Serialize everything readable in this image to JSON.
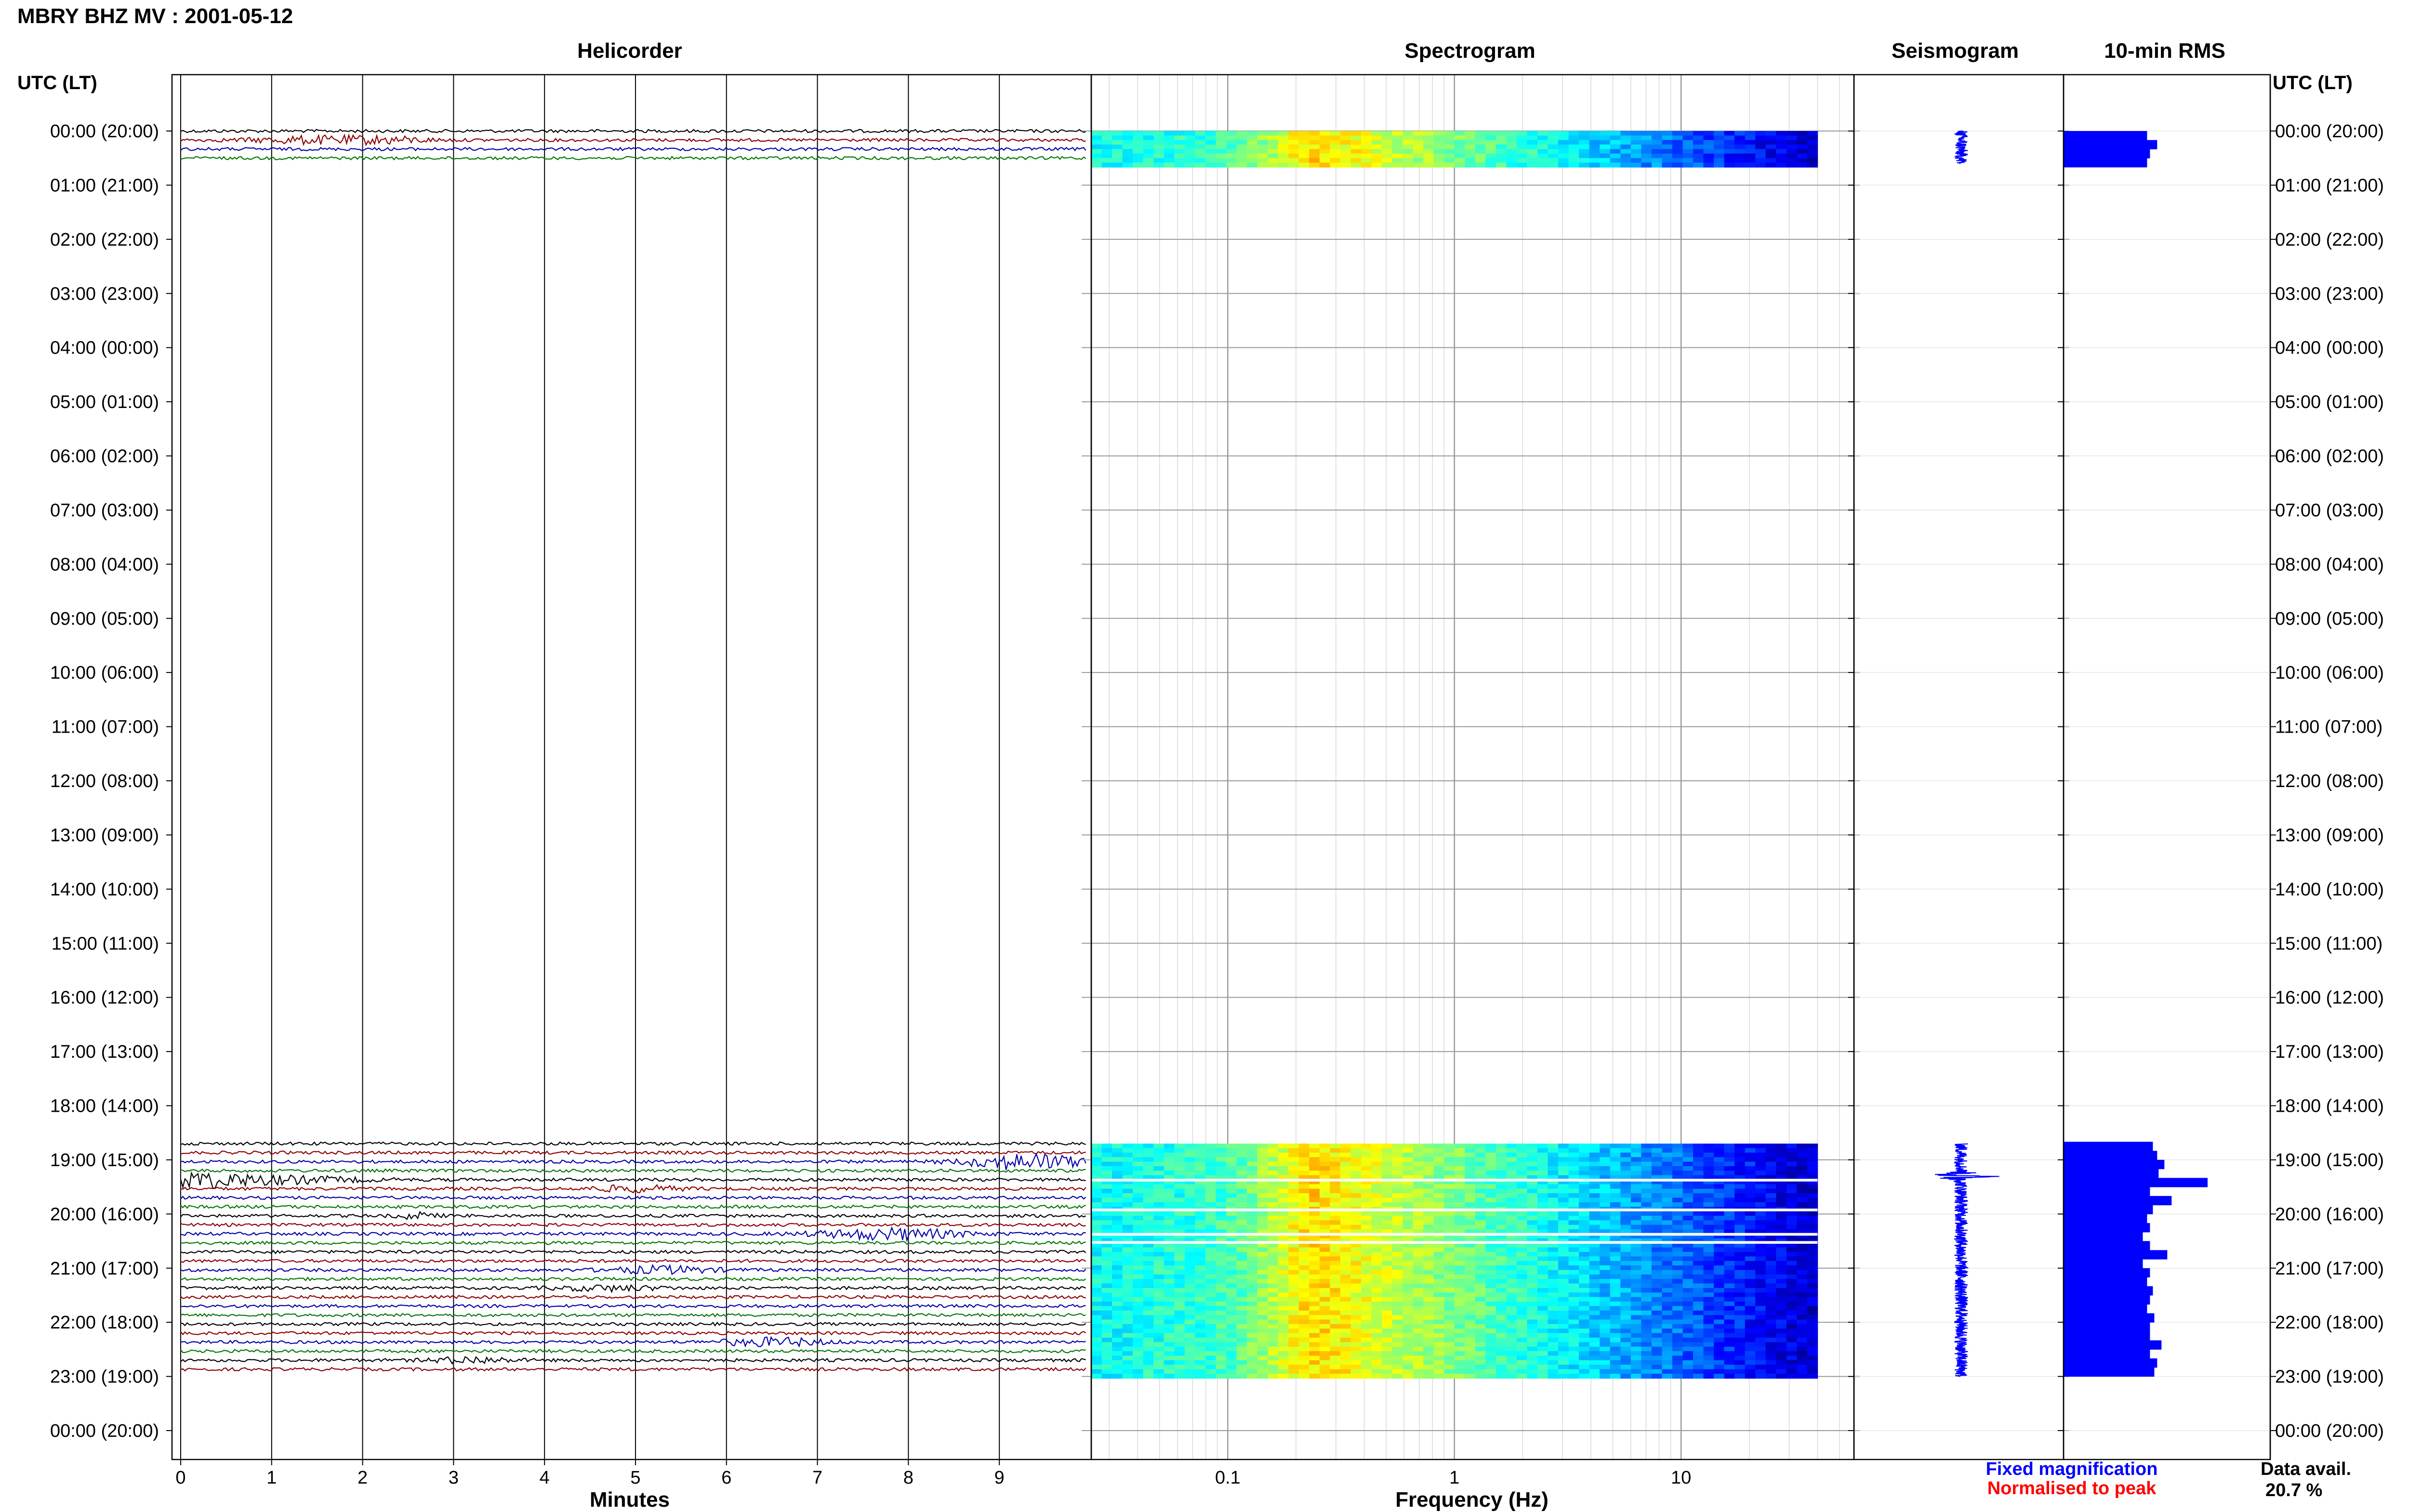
{
  "header": {
    "title": "MBRY BHZ MV : 2001-05-12"
  },
  "panels": {
    "helicorder": "Helicorder",
    "spectrogram": "Spectrogram",
    "seismogram": "Seismogram",
    "rms": "10-min RMS"
  },
  "axes": {
    "time_label_left": "UTC (LT)",
    "time_label_right": "UTC (LT)",
    "helicorder_xlabel": "Minutes",
    "spectrogram_xlabel": "Frequency (Hz)"
  },
  "legend": {
    "fixed": "Fixed magnification",
    "normalised": "Normalised to peak",
    "fixed_color": "#0000ff",
    "normalised_color": "#ff0000"
  },
  "availability": {
    "label": "Data avail.",
    "value": "20.7 %"
  },
  "colors": {
    "trace_cycle": [
      "#000000",
      "#8b0000",
      "#0000aa",
      "#007700"
    ],
    "spectrogram_low": "#00008b",
    "spectrogram_high": "#ffff00",
    "rms_bar": "#0000ff"
  },
  "chart_data": [
    {
      "type": "line",
      "title": "Helicorder",
      "xlabel": "Minutes",
      "ylabel": "UTC (LT)",
      "xlim": [
        0,
        10
      ],
      "x_ticks": [
        "0",
        "1",
        "2",
        "3",
        "4",
        "5",
        "6",
        "7",
        "8",
        "9"
      ],
      "y_ticks": [
        "00:00 (20:00)",
        "01:00 (21:00)",
        "02:00 (22:00)",
        "03:00 (23:00)",
        "04:00 (00:00)",
        "05:00 (01:00)",
        "06:00 (02:00)",
        "07:00 (03:00)",
        "08:00 (04:00)",
        "09:00 (05:00)",
        "10:00 (06:00)",
        "11:00 (07:00)",
        "12:00 (08:00)",
        "13:00 (09:00)",
        "14:00 (10:00)",
        "15:00 (11:00)",
        "16:00 (12:00)",
        "17:00 (13:00)",
        "18:00 (14:00)",
        "19:00 (15:00)",
        "20:00 (16:00)",
        "21:00 (17:00)",
        "22:00 (18:00)",
        "23:00 (19:00)",
        "00:00 (20:00)"
      ],
      "data_segments_utc_hours": [
        [
          0.0,
          0.6
        ],
        [
          18.7,
          23.0
        ]
      ],
      "trace_interval_minutes": 10
    },
    {
      "type": "heatmap",
      "title": "Spectrogram",
      "xlabel": "Frequency (Hz)",
      "x_scale": "log",
      "x_ticks": [
        "0.1",
        "1",
        "10"
      ],
      "xlim": [
        0.025,
        50
      ],
      "data_max_frequency_hz": 40,
      "energy_peak_frequency_hz": [
        0.2,
        0.3
      ],
      "data_segments_utc_hours": [
        [
          0.0,
          0.6
        ],
        [
          18.7,
          23.0
        ]
      ],
      "gaps_utc_hours": [
        [
          19.35,
          19.4
        ],
        [
          19.9,
          19.95
        ],
        [
          20.35,
          20.4
        ],
        [
          20.5,
          20.55
        ]
      ]
    },
    {
      "type": "line",
      "title": "Seismogram",
      "data_segments_utc_hours": [
        [
          0.0,
          0.6
        ],
        [
          18.7,
          23.0
        ]
      ],
      "largest_signal_utc_hours": 19.3
    },
    {
      "type": "bar",
      "title": "10-min RMS",
      "interval_minutes": 10,
      "rms_relative": {
        "00:00": 0.58,
        "00:10": 0.65,
        "00:20": 0.6,
        "00:30": 0.58,
        "18:40": 0.62,
        "18:50": 0.65,
        "19:00": 0.7,
        "19:10": 0.66,
        "19:20": 1.0,
        "19:30": 0.6,
        "19:40": 0.75,
        "19:50": 0.62,
        "20:00": 0.58,
        "20:10": 0.6,
        "20:20": 0.55,
        "20:30": 0.6,
        "20:40": 0.72,
        "20:50": 0.55,
        "21:00": 0.6,
        "21:10": 0.58,
        "21:20": 0.62,
        "21:30": 0.6,
        "21:40": 0.58,
        "21:50": 0.63,
        "22:00": 0.6,
        "22:10": 0.6,
        "22:20": 0.68,
        "22:30": 0.6,
        "22:40": 0.65,
        "22:50": 0.63
      }
    }
  ]
}
